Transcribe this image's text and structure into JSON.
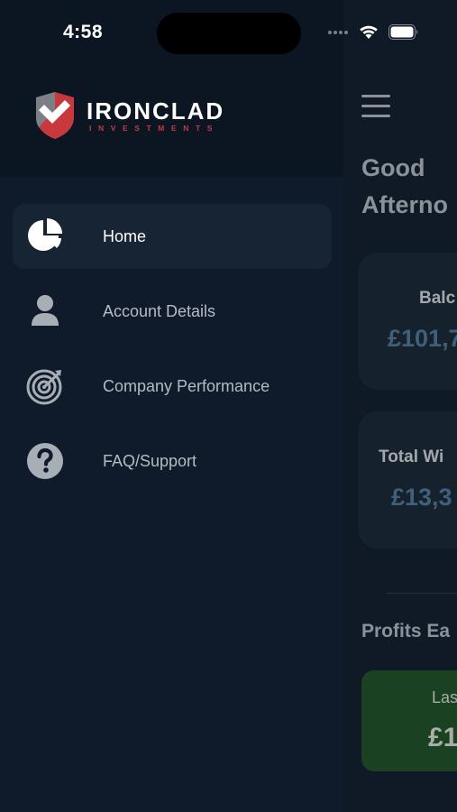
{
  "status_bar": {
    "time": "4:58"
  },
  "drawer": {
    "brand": {
      "name": "IRONCLAD",
      "tagline": "INVESTMENTS"
    },
    "items": [
      {
        "label": "Home",
        "icon": "pie-chart-icon",
        "active": true
      },
      {
        "label": "Account Details",
        "icon": "user-icon",
        "active": false
      },
      {
        "label": "Company Performance",
        "icon": "target-icon",
        "active": false
      },
      {
        "label": "FAQ/Support",
        "icon": "question-circle-icon",
        "active": false
      }
    ]
  },
  "main": {
    "greeting_line1": "Good",
    "greeting_line2": "Afterno",
    "balance_label": "Balc",
    "balance_value": "£101,7",
    "withdrawals_label": "Total Wi",
    "withdrawals_value": "£13,3",
    "profits_heading": "Profits Ea",
    "profit_card_label": "Las",
    "profit_card_value": "£1"
  },
  "colors": {
    "drawer_bg": "#0f1b2a",
    "header_bg": "#0c1623",
    "active_item_bg": "#172433",
    "brand_red": "#c7393c",
    "profit_card_bg": "#1a4121",
    "value_blue": "#3f6078"
  }
}
